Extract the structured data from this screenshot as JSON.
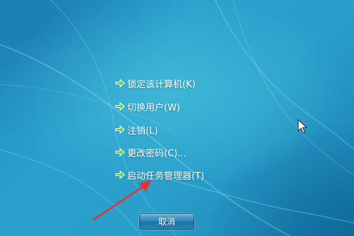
{
  "menu": {
    "items": [
      {
        "label": "锁定该计算机(K)",
        "icon": "green-arrow-icon"
      },
      {
        "label": "切换用户(W)",
        "icon": "green-arrow-icon"
      },
      {
        "label": "注销(L)",
        "icon": "green-arrow-icon"
      },
      {
        "label": "更改密码(C)...",
        "icon": "green-arrow-icon"
      },
      {
        "label": "启动任务管理器(T)",
        "icon": "green-arrow-icon"
      }
    ]
  },
  "cancel_button": {
    "label": "取消"
  },
  "annotation": {
    "icon": "red-arrow-icon",
    "color": "#e8322b"
  },
  "colors": {
    "background": "#2a9fcb",
    "menu_icon": "#5fcf3a"
  }
}
